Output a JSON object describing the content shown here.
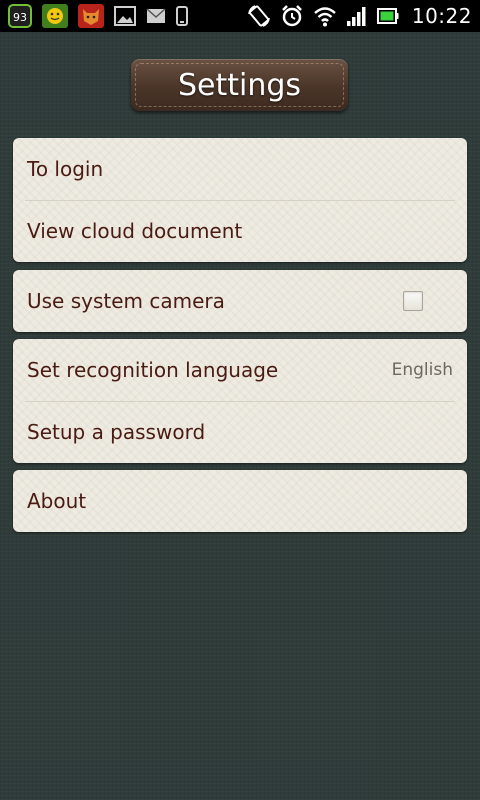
{
  "status_bar": {
    "notification_badge": "93",
    "time": "10:22"
  },
  "header": {
    "title": "Settings"
  },
  "groups": [
    {
      "items": [
        {
          "label": "To login"
        },
        {
          "label": "View cloud document"
        }
      ]
    },
    {
      "items": [
        {
          "label": "Use system camera",
          "checked": false
        }
      ]
    },
    {
      "items": [
        {
          "label": "Set recognition language",
          "value": "English"
        },
        {
          "label": "Setup a password"
        }
      ]
    },
    {
      "items": [
        {
          "label": "About"
        }
      ]
    }
  ],
  "colors": {
    "background": "#2f3c3a",
    "card": "#eeebe2",
    "label_text": "#4a1b12",
    "title_badge": "#4a3528"
  },
  "icons": [
    "badge-93-icon",
    "smiley-app-icon",
    "fox-app-icon",
    "gallery-icon",
    "mail-icon",
    "phone-icon",
    "rotate-icon",
    "alarm-clock-icon",
    "wifi-icon",
    "signal-icon",
    "battery-icon"
  ]
}
